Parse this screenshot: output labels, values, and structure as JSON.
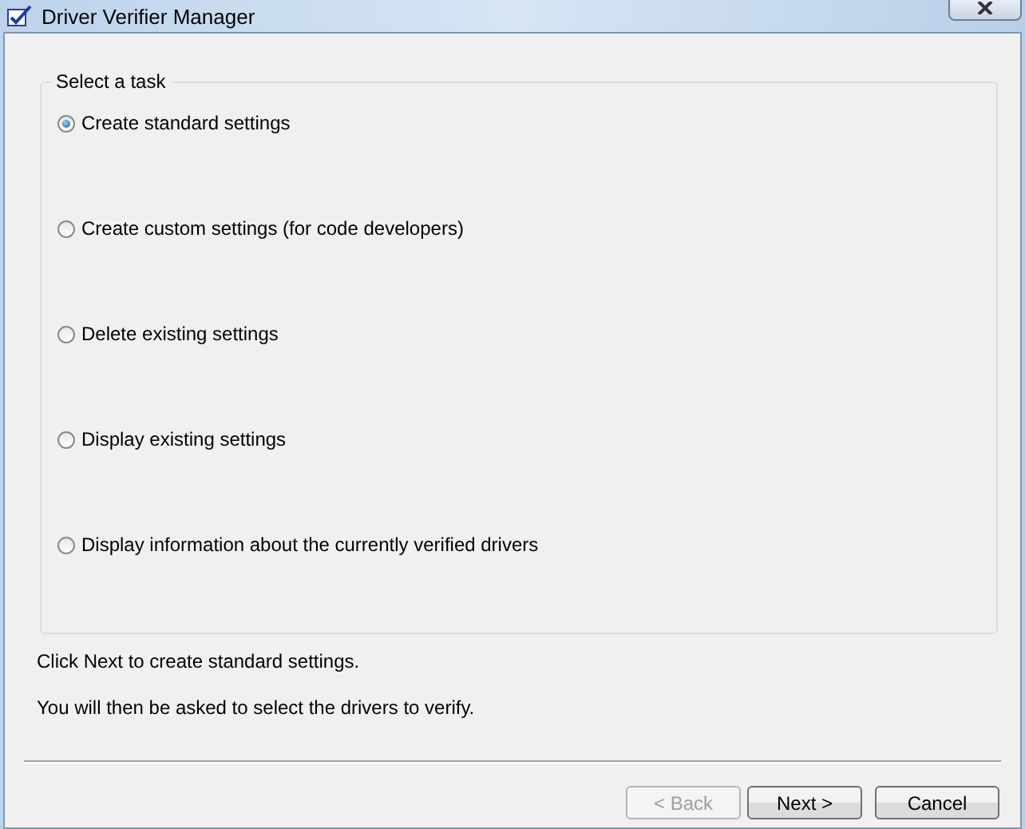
{
  "window": {
    "title": "Driver Verifier Manager"
  },
  "group": {
    "title": "Select a task",
    "options": [
      {
        "label": "Create standard settings",
        "selected": true
      },
      {
        "label": "Create custom settings (for code developers)",
        "selected": false
      },
      {
        "label": "Delete existing settings",
        "selected": false
      },
      {
        "label": "Display existing settings",
        "selected": false
      },
      {
        "label": "Display information about the currently verified drivers",
        "selected": false
      }
    ]
  },
  "messages": [
    "Click Next to create standard settings.",
    "You will then be asked to select the drivers to verify."
  ],
  "buttons": [
    {
      "label": "< Back",
      "disabled": true
    },
    {
      "label": "Next >",
      "disabled": false
    },
    {
      "label": "Cancel",
      "disabled": false
    }
  ]
}
